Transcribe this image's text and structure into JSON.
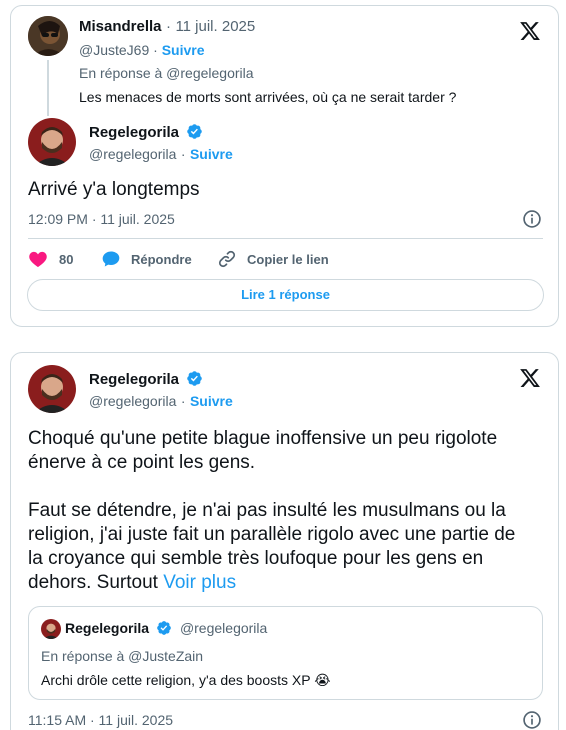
{
  "tweet1": {
    "parent": {
      "name": "Misandrella",
      "separator": "·",
      "date": "11 juil. 2025",
      "handle": "@JusteJ69",
      "follow": "Suivre",
      "reply_to": "En réponse à @regelegorila",
      "text": "Les menaces de morts sont arrivées, où ça ne serait tarder ?"
    },
    "reply": {
      "name": "Regelegorila",
      "handle": "@regelegorila",
      "follow": "Suivre",
      "text": "Arrivé y'a longtemps",
      "timestamp": "12:09 PM · 11 juil. 2025"
    },
    "actions": {
      "likes": "80",
      "reply_label": "Répondre",
      "copy_label": "Copier le lien"
    },
    "read_replies": "Lire 1 réponse"
  },
  "tweet2": {
    "name": "Regelegorila",
    "handle": "@regelegorila",
    "follow": "Suivre",
    "para1_line1": "Choqué qu'une petite blague inoffensive un peu rigolote",
    "para1_line2": "énerve à ce point les gens.",
    "para2_line1": "Faut se détendre, je n'ai pas insulté les musulmans ou la",
    "para2_line2": "religion, j'ai juste fait un parallèle rigolo avec une partie de",
    "para2_line3": "la croyance qui semble très loufoque pour les gens en",
    "para2_line4": "dehors. Surtout",
    "see_more": "Voir plus",
    "quote": {
      "name": "Regelegorila",
      "handle": "@regelegorila",
      "reply_to": "En réponse à @JusteZain",
      "text": "Archi drôle cette religion, y'a des boosts XP",
      "emoji": "😭"
    },
    "timestamp": "11:15 AM · 11 juil. 2025"
  },
  "colors": {
    "accent": "#1d9bf0",
    "like": "#f91880",
    "text": "#0f1419",
    "muted": "#536471",
    "border": "#cfd9de"
  },
  "icons": [
    "x-logo-icon",
    "verified-badge-icon",
    "heart-icon",
    "reply-bubble-icon",
    "link-icon",
    "info-icon"
  ]
}
